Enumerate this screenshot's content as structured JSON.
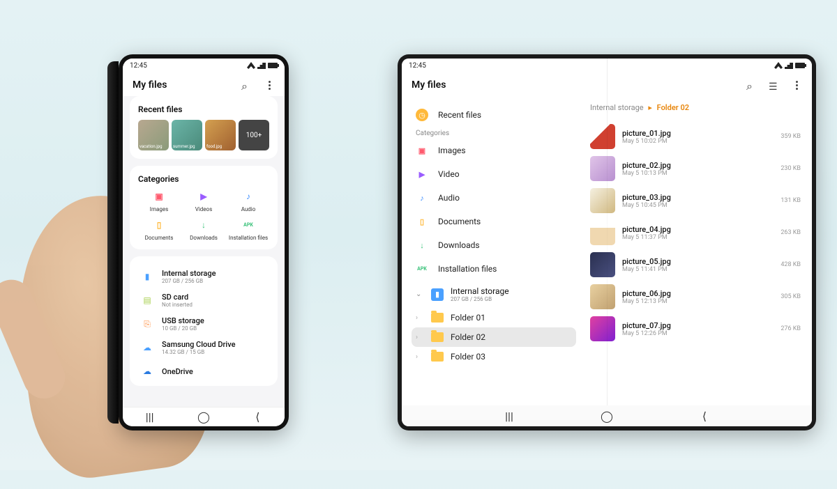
{
  "status": {
    "time": "12:45"
  },
  "app": {
    "title": "My files"
  },
  "phone": {
    "recent": {
      "heading": "Recent files",
      "thumbs": [
        "vacation.jpg",
        "summer.jpg",
        "food.jpg"
      ],
      "more": "100+"
    },
    "categories": {
      "heading": "Categories",
      "items": [
        {
          "label": "Images",
          "color": "#ff5a6e",
          "glyph": "▣"
        },
        {
          "label": "Videos",
          "color": "#9a5cff",
          "glyph": "▶"
        },
        {
          "label": "Audio",
          "color": "#3a8cff",
          "glyph": "♪"
        },
        {
          "label": "Documents",
          "color": "#ffb93a",
          "glyph": "▯"
        },
        {
          "label": "Downloads",
          "color": "#3ac27a",
          "glyph": "↓"
        },
        {
          "label": "Installation files",
          "color": "#3ac27a",
          "glyph": "APK"
        }
      ]
    },
    "storage": [
      {
        "name": "Internal storage",
        "sub": "207 GB / 256 GB",
        "color": "#4aa0ff",
        "glyph": "▮"
      },
      {
        "name": "SD card",
        "sub": "Not inserted",
        "color": "#a8d050",
        "glyph": "▤"
      },
      {
        "name": "USB storage",
        "sub": "10 GB / 20 GB",
        "color": "#ff8a3a",
        "glyph": "⎘"
      },
      {
        "name": "Samsung Cloud Drive",
        "sub": "14.32 GB / 15 GB",
        "color": "#4aa0ff",
        "glyph": "☁"
      },
      {
        "name": "OneDrive",
        "sub": "",
        "color": "#2a7ae0",
        "glyph": "☁"
      }
    ]
  },
  "tablet": {
    "sidebar": {
      "recent": "Recent files",
      "section": "Categories",
      "items": [
        {
          "label": "Images",
          "color": "#ff5a6e",
          "glyph": "▣"
        },
        {
          "label": "Video",
          "color": "#9a5cff",
          "glyph": "▶"
        },
        {
          "label": "Audio",
          "color": "#3a8cff",
          "glyph": "♪"
        },
        {
          "label": "Documents",
          "color": "#ffb93a",
          "glyph": "▯"
        },
        {
          "label": "Downloads",
          "color": "#3ac27a",
          "glyph": "↓"
        },
        {
          "label": "Installation files",
          "color": "#3ac27a",
          "glyph": "APK"
        }
      ],
      "storage": {
        "name": "Internal storage",
        "sub": "207 GB / 256 GB"
      },
      "folders": [
        "Folder 01",
        "Folder 02",
        "Folder 03"
      ],
      "selected": 1
    },
    "breadcrumb": {
      "root": "Internal storage",
      "current": "Folder 02"
    },
    "files": [
      {
        "name": "picture_01.jpg",
        "date": "May 5 10:02 PM",
        "size": "359 KB",
        "cls": "ft1"
      },
      {
        "name": "picture_02.jpg",
        "date": "May 5 10:13 PM",
        "size": "230 KB",
        "cls": "ft2"
      },
      {
        "name": "picture_03.jpg",
        "date": "May 5 10:45 PM",
        "size": "131 KB",
        "cls": "ft3"
      },
      {
        "name": "picture_04.jpg",
        "date": "May 5 11:37 PM",
        "size": "263 KB",
        "cls": "ft4"
      },
      {
        "name": "picture_05.jpg",
        "date": "May 5 11:41 PM",
        "size": "428 KB",
        "cls": "ft5"
      },
      {
        "name": "picture_06.jpg",
        "date": "May 5 12:13 PM",
        "size": "305 KB",
        "cls": "ft6"
      },
      {
        "name": "picture_07.jpg",
        "date": "May 5 12:26 PM",
        "size": "276 KB",
        "cls": "ft7"
      }
    ]
  }
}
